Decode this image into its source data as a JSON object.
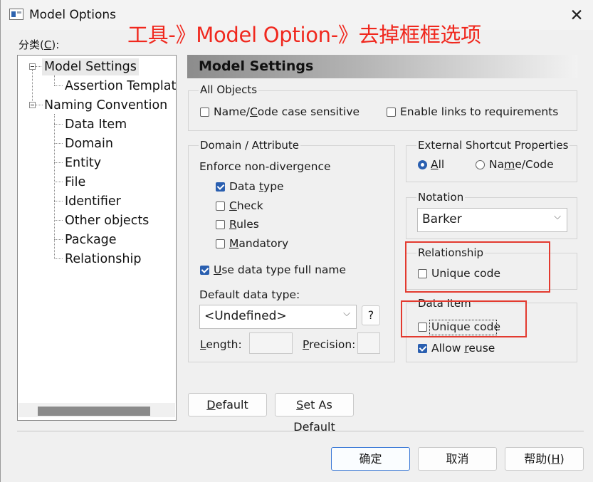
{
  "window": {
    "title": "Model Options",
    "close_glyph": "✕",
    "annotation": "工具-》Model Option-》去掉框框选项",
    "annotation_color": "#f0281e"
  },
  "category": {
    "label": "分类(C):",
    "tree": [
      {
        "label": "Model Settings",
        "level": 0,
        "expanded": true,
        "selected": true
      },
      {
        "label": "Assertion Templat",
        "level": 1
      },
      {
        "label": "Naming Convention",
        "level": 0,
        "expanded": true
      },
      {
        "label": "Data Item",
        "level": 1
      },
      {
        "label": "Domain",
        "level": 1
      },
      {
        "label": "Entity",
        "level": 1
      },
      {
        "label": "File",
        "level": 1
      },
      {
        "label": "Identifier",
        "level": 1
      },
      {
        "label": "Other objects",
        "level": 1
      },
      {
        "label": "Package",
        "level": 1
      },
      {
        "label": "Relationship",
        "level": 1
      }
    ]
  },
  "panel": {
    "header": "Model Settings",
    "all_objects": {
      "title": "All Objects",
      "name_code_case": {
        "label": "Name/Code case sensitive",
        "checked": false
      },
      "enable_links": {
        "label": "Enable links to requirements",
        "checked": false
      }
    },
    "domain_attribute": {
      "title": "Domain / Attribute",
      "enforce_label": "Enforce non-divergence",
      "data_type": {
        "label": "Data type",
        "checked": true
      },
      "check": {
        "label": "Check",
        "checked": false
      },
      "rules": {
        "label": "Rules",
        "checked": false
      },
      "mandatory": {
        "label": "Mandatory",
        "checked": false
      },
      "use_full_name": {
        "label": "Use data type full name",
        "checked": true
      },
      "default_type_label": "Default data type:",
      "default_type_value": "<Undefined>",
      "help_button": "?",
      "length_label": "Length:",
      "length_value": "",
      "precision_label": "Precision:",
      "precision_value": ""
    },
    "external_shortcut": {
      "title": "External Shortcut Properties",
      "all": {
        "label": "All",
        "selected": true
      },
      "name_code": {
        "label": "Name/Code",
        "selected": false
      }
    },
    "notation": {
      "title": "Notation",
      "value": "Barker"
    },
    "relationship": {
      "title": "Relationship",
      "unique_code": {
        "label": "Unique code",
        "checked": false
      }
    },
    "data_item": {
      "title": "Data Item",
      "unique_code": {
        "label": "Unique code",
        "checked": false
      },
      "allow_reuse": {
        "label": "Allow reuse",
        "checked": true
      }
    },
    "default_button": "Default",
    "set_as_default_button": "Set As Default"
  },
  "footer": {
    "ok": "确定",
    "cancel": "取消",
    "help": "帮助(H)"
  },
  "colors": {
    "checkbox_accent": "#2a5fb0",
    "highlight_box": "#e33a2f"
  }
}
